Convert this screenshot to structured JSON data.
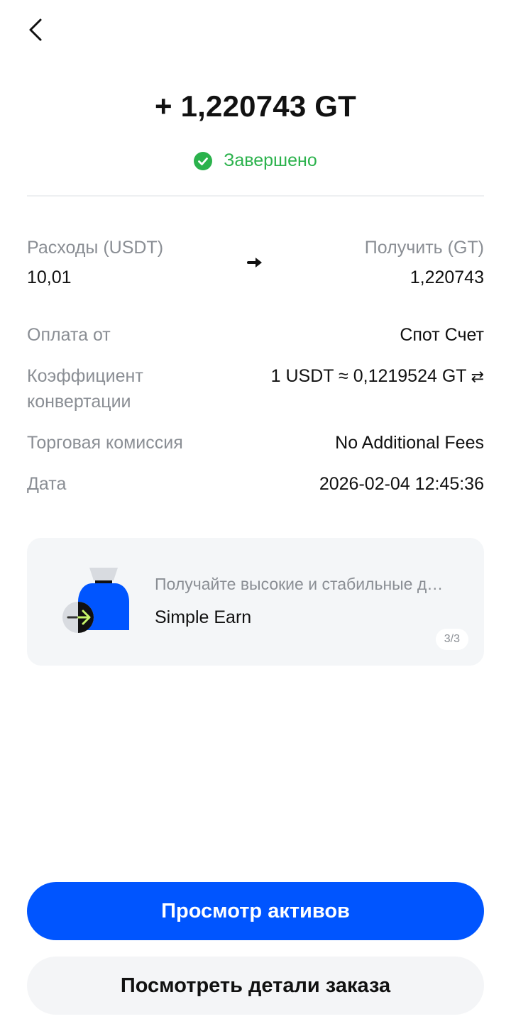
{
  "header": {
    "amount": "+ 1,220743 GT",
    "status": "Завершено"
  },
  "exchange": {
    "spend_label": "Расходы (USDT)",
    "spend_value": "10,01",
    "receive_label": "Получить (GT)",
    "receive_value": "1,220743"
  },
  "details": [
    {
      "label": "Оплата от",
      "value": "Спот Счет"
    },
    {
      "label": "Коэффициент конвертации",
      "value": "1 USDT ≈ 0,1219524 GT"
    },
    {
      "label": "Торговая комиссия",
      "value": "No Additional Fees"
    },
    {
      "label": "Дата",
      "value": "2026-02-04 12:45:36"
    }
  ],
  "promo": {
    "subtitle": "Получайте высокие и стабильные д…",
    "title": "Simple Earn",
    "page_indicator": "3/3"
  },
  "buttons": {
    "primary": "Просмотр активов",
    "secondary": "Посмотреть детали заказа"
  },
  "colors": {
    "accent": "#0055ff",
    "success": "#2bb24c",
    "muted_text": "#8a8e94",
    "card_bg": "#f4f6f8"
  },
  "icons": [
    "back-chevron-icon",
    "check-circle-icon",
    "arrow-right-icon",
    "swap-arrows-icon",
    "money-bag-icon"
  ]
}
